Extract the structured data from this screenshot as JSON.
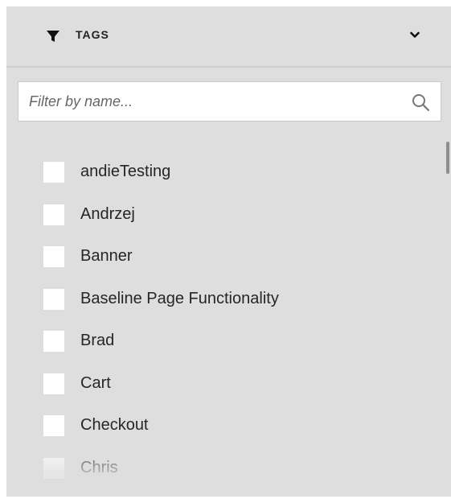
{
  "header": {
    "icon": "filter-icon",
    "title": "TAGS",
    "toggle_icon": "chevron-down-icon"
  },
  "search": {
    "placeholder": "Filter by name...",
    "value": "",
    "icon": "search-icon"
  },
  "tags": [
    {
      "label": "andieTesting",
      "checked": false
    },
    {
      "label": "Andrzej",
      "checked": false
    },
    {
      "label": "Banner",
      "checked": false
    },
    {
      "label": "Baseline Page Functionality",
      "checked": false
    },
    {
      "label": "Brad",
      "checked": false
    },
    {
      "label": "Cart",
      "checked": false
    },
    {
      "label": "Checkout",
      "checked": false
    },
    {
      "label": "Chris",
      "checked": false
    }
  ],
  "colors": {
    "panel_background": "#dedede",
    "text": "#262626",
    "checkbox": "#ffffff"
  }
}
